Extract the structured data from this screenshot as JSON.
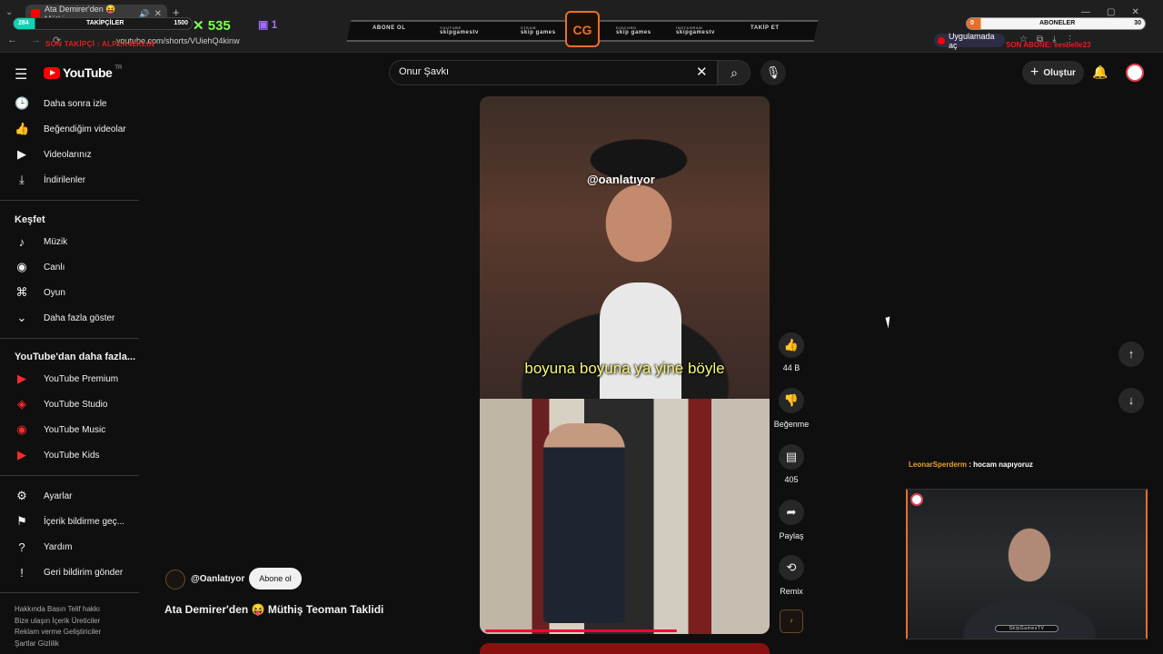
{
  "browser": {
    "tab_title": "Ata Demirer'den 😝 Müthiş",
    "url": "youtube.com/shorts/VUiehQ4kinw",
    "open_in_app": "Uygulamada aç"
  },
  "stream_overlay": {
    "followers_label": "TAKİPÇİLER",
    "followers_current": "284",
    "followers_goal": "1500",
    "last_follower": "SON TAKİPÇİ : ALPER42KLIN",
    "viewer_count": "535",
    "twitch_count": "1",
    "banner_items": [
      {
        "sub": "",
        "label": "ABONE OL"
      },
      {
        "sub": "YOUTUBE",
        "label": "skipgamestv"
      },
      {
        "sub": "STEAM",
        "label": "skip games"
      },
      {
        "sub": "DISCORD",
        "label": "skip games"
      },
      {
        "sub": "INSTAGRAM",
        "label": "skipgamestv"
      },
      {
        "sub": "",
        "label": "TAKİP ET"
      }
    ],
    "logo_text": "CG",
    "subs_label": "ABONELER",
    "subs_current": "0",
    "subs_goal": "30",
    "last_sub": "SON ABONE: eesbelle23",
    "chat_user": "LeonarSperderm",
    "chat_message": " : hocam napıyoruz",
    "webcam_tag": "SkipGamesTV"
  },
  "header": {
    "logo": "YouTube",
    "logo_region": "TR",
    "search_value": "Onur Şavkı",
    "create_label": "Oluştur"
  },
  "sidebar": {
    "top_items": [
      {
        "icon": "clock-icon",
        "label": "Daha sonra izle"
      },
      {
        "icon": "thumbs-up-icon",
        "label": "Beğendiğim videolar"
      },
      {
        "icon": "video-icon",
        "label": "Videolarınız"
      },
      {
        "icon": "download-icon",
        "label": "İndirilenler"
      }
    ],
    "explore_title": "Keşfet",
    "explore_items": [
      {
        "icon": "music-icon",
        "label": "Müzik"
      },
      {
        "icon": "live-icon",
        "label": "Canlı"
      },
      {
        "icon": "gamepad-icon",
        "label": "Oyun"
      },
      {
        "icon": "chevron-down-icon",
        "label": "Daha fazla göster"
      }
    ],
    "more_title": "YouTube'dan daha fazla...",
    "more_items": [
      {
        "icon": "youtube-premium-icon",
        "label": "YouTube Premium"
      },
      {
        "icon": "youtube-studio-icon",
        "label": "YouTube Studio"
      },
      {
        "icon": "youtube-music-icon",
        "label": "YouTube Music"
      },
      {
        "icon": "youtube-kids-icon",
        "label": "YouTube Kids"
      }
    ],
    "settings_items": [
      {
        "icon": "gear-icon",
        "label": "Ayarlar"
      },
      {
        "icon": "flag-icon",
        "label": "İçerik bildirme geç..."
      },
      {
        "icon": "help-icon",
        "label": "Yardım"
      },
      {
        "icon": "feedback-icon",
        "label": "Geri bildirim gönder"
      }
    ],
    "footer_lines": [
      "Hakkında  Basın  Telif hakkı",
      "Bize ulaşın  İçerik Üreticiler",
      "Reklam verme  Geliştiriciler",
      "Şartlar  Gizlilik"
    ]
  },
  "short": {
    "watermark": "@oanlatıyor",
    "caption": "boyuna boyuna ya yine böyle",
    "channel": "@Oanlatıyor",
    "subscribe_label": "Abone ol",
    "title": "Ata Demirer'den 😝 Müthiş Teoman Taklidi",
    "progress": 0.69
  },
  "actions": {
    "like_count": "44 B",
    "dislike_label": "Beğenme",
    "comment_count": "405",
    "share_label": "Paylaş",
    "remix_label": "Remix"
  },
  "colors": {
    "background": "#0f0f0f",
    "brand_red": "#ff0000",
    "overlay_orange": "#e8702a",
    "caption_yellow": "#f7f774"
  }
}
